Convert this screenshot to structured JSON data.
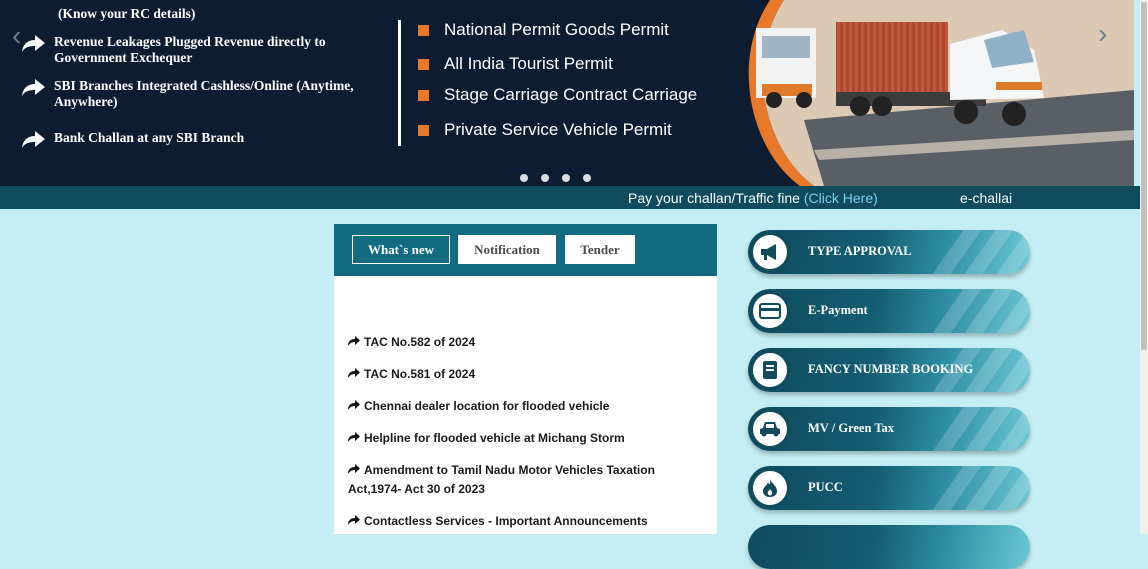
{
  "banner": {
    "rc_line": "(Know your RC details)",
    "benefits": [
      "Revenue Leakages Plugged Revenue directly to Government Exchequer",
      "SBI Branches Integrated Cashless/Online (Anytime, Anywhere)",
      "Bank Challan at any SBI Branch"
    ],
    "permits": [
      "National Permit Goods Permit",
      "All India Tourist Permit",
      "Stage Carriage Contract Carriage",
      "Private Service Vehicle Permit"
    ],
    "prev_icon": "chevron-left-icon",
    "next_icon": "chevron-right-icon",
    "slide_count": 4
  },
  "ticker": {
    "text": "Pay your challan/Traffic fine ",
    "link": "(Click Here)",
    "text2": "e-challai"
  },
  "news": {
    "tabs": [
      "What`s new",
      "Notification",
      "Tender"
    ],
    "items": [
      "TAC No.582 of 2024",
      "TAC No.581 of 2024",
      "Chennai dealer location for flooded vehicle",
      "Helpline for flooded vehicle at Michang Storm",
      "Amendment to Tamil Nadu Motor Vehicles Taxation Act,1974- Act 30 of 2023",
      "Contactless Services - Important Announcements"
    ]
  },
  "services": [
    {
      "label": "TYPE APPROVAL",
      "icon": "megaphone-icon"
    },
    {
      "label": "E-Payment",
      "icon": "credit-card-icon"
    },
    {
      "label": "FANCY NUMBER BOOKING",
      "icon": "book-icon"
    },
    {
      "label": "MV / Green Tax",
      "icon": "car-icon"
    },
    {
      "label": "PUCC",
      "icon": "flame-icon"
    }
  ],
  "colors": {
    "banner_bg": "#0d1c31",
    "accent_orange": "#e8792b",
    "teal_dark": "#0f4a5d",
    "teal": "#136b82",
    "page_bg": "#c4eef3"
  }
}
